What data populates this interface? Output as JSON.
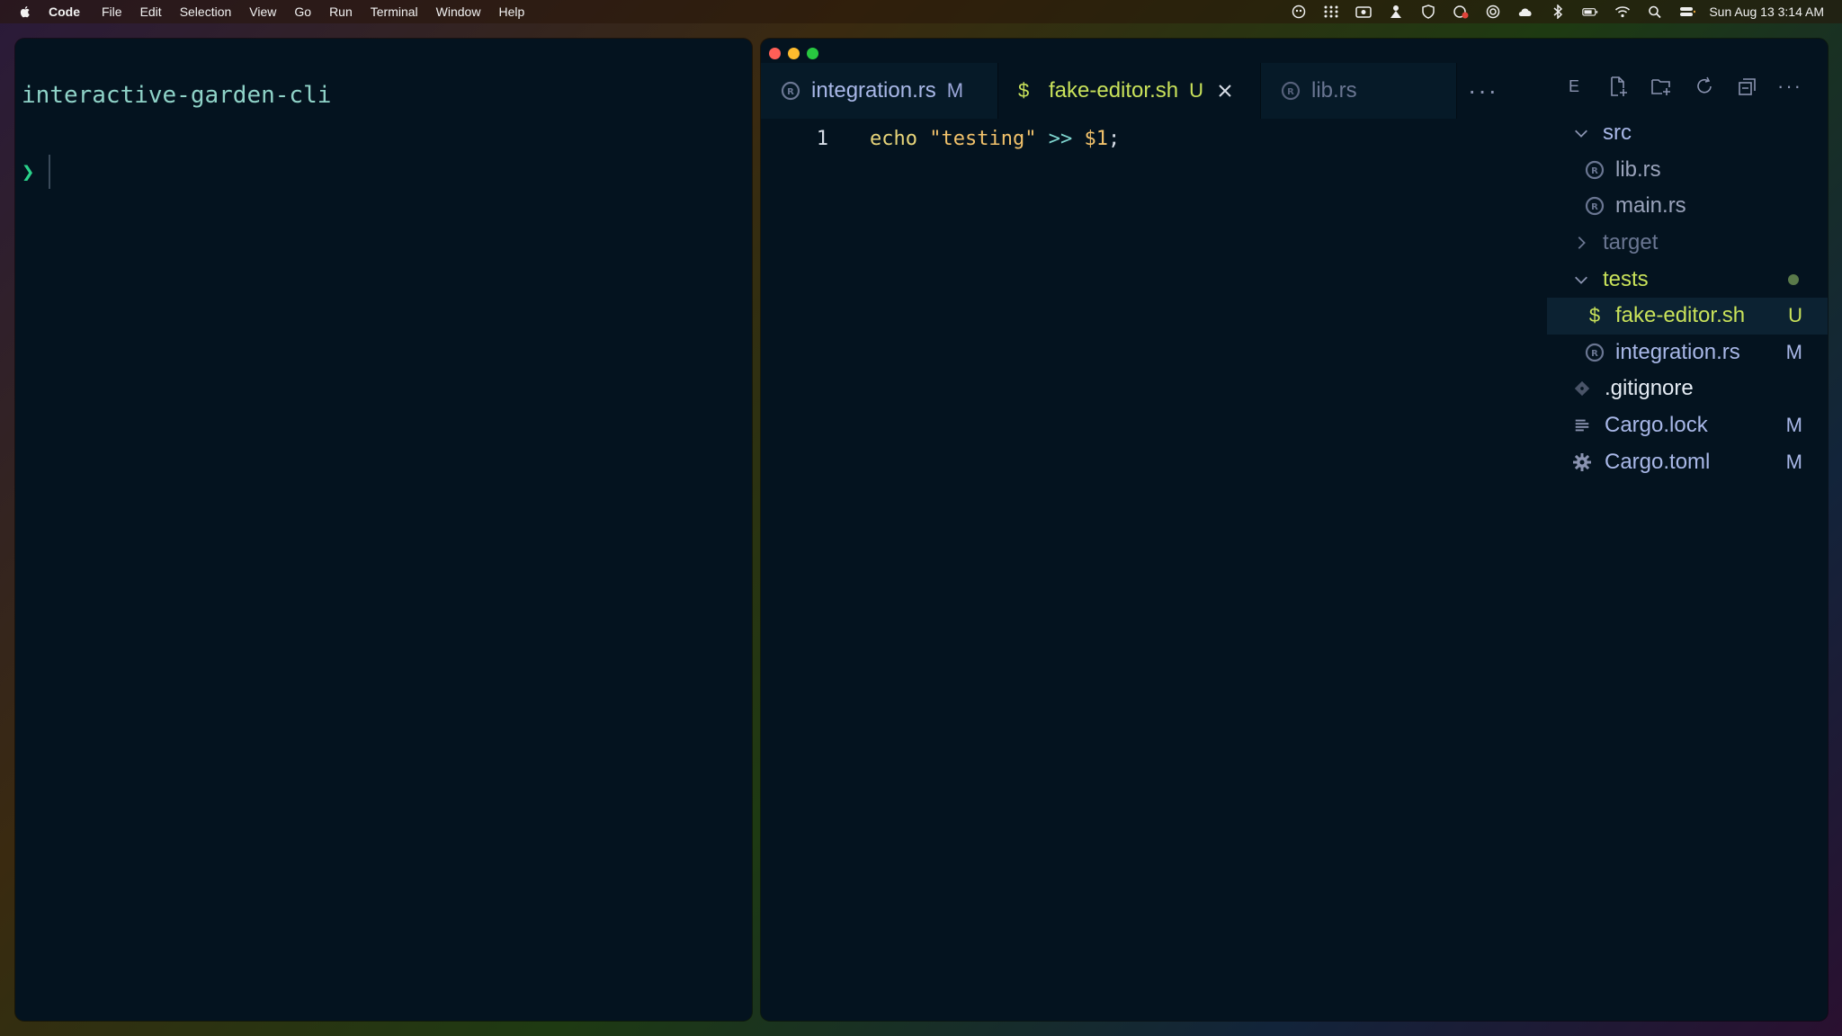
{
  "menubar": {
    "app_name": "Code",
    "items": [
      "File",
      "Edit",
      "Selection",
      "View",
      "Go",
      "Run",
      "Terminal",
      "Window",
      "Help"
    ],
    "clock": "Sun Aug 13  3:14 AM"
  },
  "terminal": {
    "cwd": "interactive-garden-cli",
    "prompt": "❯"
  },
  "editor": {
    "tabs": [
      {
        "label": "integration.rs",
        "status": "M"
      },
      {
        "label": "fake-editor.sh",
        "status": "U"
      },
      {
        "label": "lib.rs",
        "status": ""
      }
    ],
    "more": "···",
    "code": {
      "line_number": "1",
      "tokens": {
        "kw": "echo",
        "str": "\"testing\"",
        "op": ">>",
        "var": "$1",
        "end": ";"
      }
    }
  },
  "explorer": {
    "header_label": "E",
    "more": "···",
    "tree": [
      {
        "name": "src",
        "type": "folder-open",
        "badge": ""
      },
      {
        "name": "lib.rs",
        "type": "rust",
        "badge": ""
      },
      {
        "name": "main.rs",
        "type": "rust",
        "badge": ""
      },
      {
        "name": "target",
        "type": "folder-closed",
        "badge": ""
      },
      {
        "name": "tests",
        "type": "folder-open",
        "badge": ""
      },
      {
        "name": "fake-editor.sh",
        "type": "shell",
        "badge": "U"
      },
      {
        "name": "integration.rs",
        "type": "rust",
        "badge": "M"
      },
      {
        "name": ".gitignore",
        "type": "git",
        "badge": ""
      },
      {
        "name": "Cargo.lock",
        "type": "lock",
        "badge": "M"
      },
      {
        "name": "Cargo.toml",
        "type": "gear",
        "badge": "M"
      }
    ]
  },
  "colors": {
    "window_bg": "#04131f",
    "accent_lime": "#c9e25a",
    "modified_blue": "#a9b8e8"
  }
}
